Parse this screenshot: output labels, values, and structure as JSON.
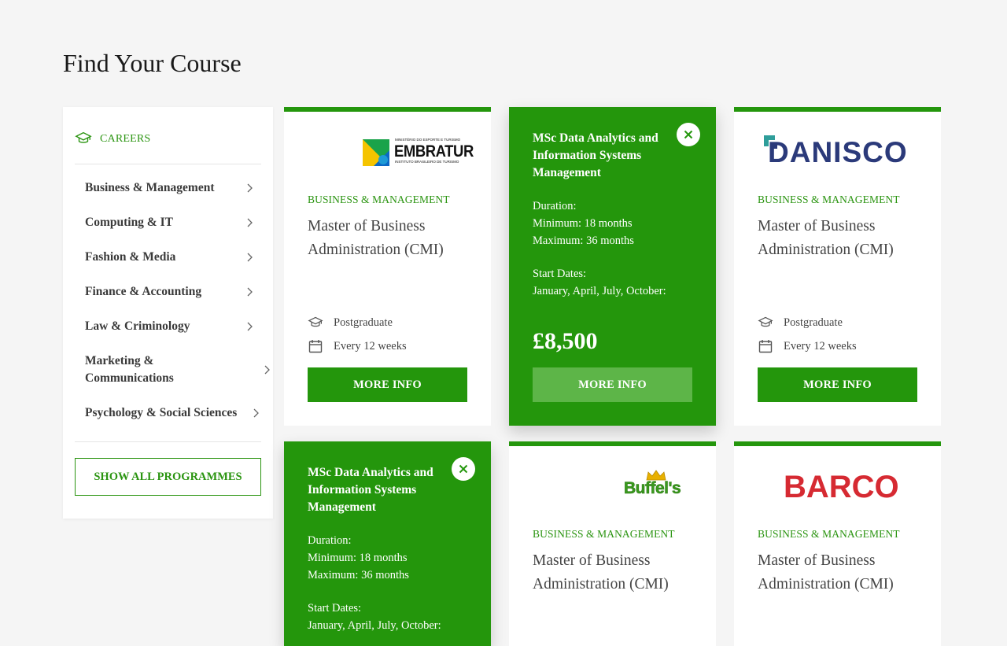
{
  "page": {
    "title": "Find Your Course"
  },
  "sidebar": {
    "heading": "CAREERS",
    "categories": [
      "Business & Management",
      "Computing & IT",
      "Fashion & Media",
      "Finance & Accounting",
      "Law & Criminology",
      "Marketing & Communications",
      "Psychology & Social Sciences"
    ],
    "show_all_label": "SHOW ALL PROGRAMMES"
  },
  "cards": [
    {
      "logo": "EMBRATUR",
      "logo_line1": "MINISTÉRIO DO ESPORTE E TURISMO",
      "logo_line2": "INSTITUTO BRASILEIRO DE TURISMO",
      "category": "BUSINESS & MANAGEMENT",
      "title": "Master of Business Administration (CMI)",
      "level": "Postgraduate",
      "frequency": "Every 12 weeks",
      "button": "MORE INFO"
    },
    {
      "title": "MSc Data Analytics and Information Systems Management",
      "duration_label": "Duration:",
      "duration_min": "Minimum: 18 months",
      "duration_max": "Maximum: 36 months",
      "start_label": "Start Dates:",
      "start_dates": "January, April, July, October:",
      "price": "£8,500",
      "button": "MORE INFO"
    },
    {
      "logo": "DANISCO",
      "category": "BUSINESS & MANAGEMENT",
      "title": "Master of Business Administration (CMI)",
      "level": "Postgraduate",
      "frequency": "Every 12 weeks",
      "button": "MORE INFO"
    },
    {
      "title": "MSc Data Analytics and Information Systems Management",
      "duration_label": "Duration:",
      "duration_min": "Minimum: 18 months",
      "duration_max": "Maximum: 36 months",
      "start_label": "Start Dates:",
      "start_dates": "January, April, July, October:"
    },
    {
      "logo": "Buffel's",
      "category": "BUSINESS & MANAGEMENT",
      "title": "Master of Business Administration (CMI)"
    },
    {
      "logo": "BARCO",
      "category": "BUSINESS & MANAGEMENT",
      "title": "Master of Business Administration (CMI)"
    }
  ],
  "colors": {
    "accent": "#24960c",
    "button_light": "#5db548",
    "background": "#f5f5f5"
  },
  "icons": [
    "graduation-cap-icon",
    "chevron-right-icon",
    "calendar-icon",
    "close-icon"
  ]
}
